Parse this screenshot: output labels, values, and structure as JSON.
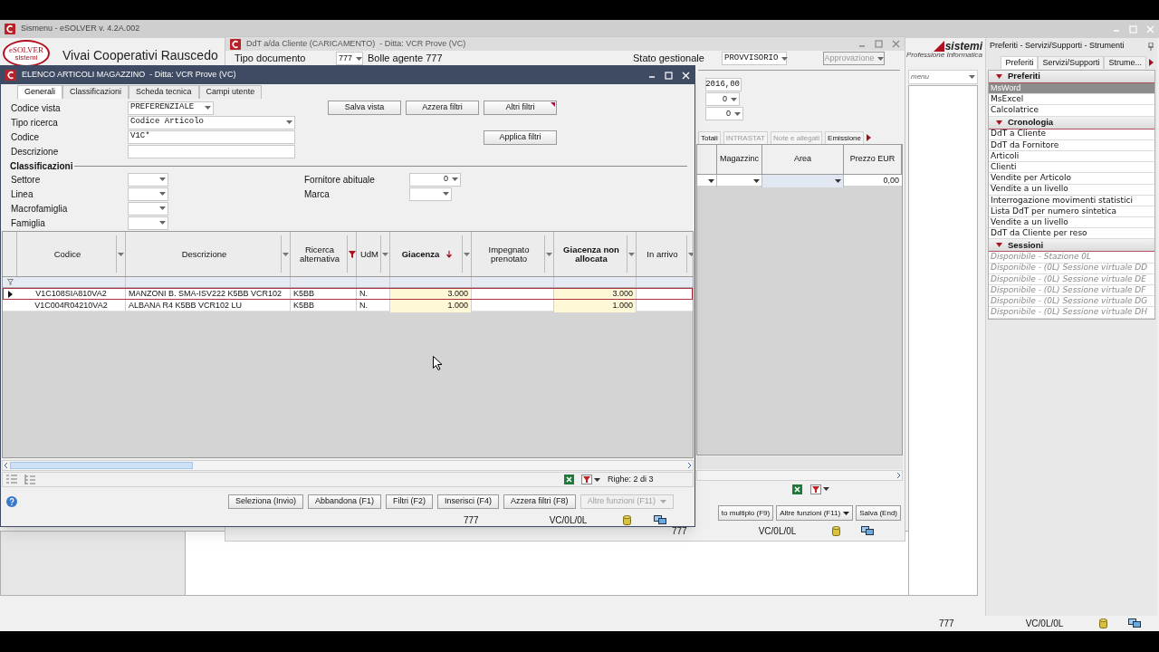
{
  "desktop_window": {
    "title": "Sismenu - eSOLVER v. 4.2A.002",
    "logo": "eSOLVER",
    "logo_tagline": "sistemi",
    "company": "Vivai Cooperativi Rauscedo",
    "brand": "sistemi",
    "brand_tagline": "Professione Informatica",
    "menu_field": "menu",
    "status_bar": [
      "777",
      "VC/0L/0L"
    ]
  },
  "side_panel": {
    "title": "Preferiti - Servizi/Supporti - Strumenti",
    "tabs": [
      {
        "label": "Preferiti",
        "selected": true
      },
      {
        "label": "Servizi/Supporti",
        "selected": false
      },
      {
        "label": "Strume...",
        "selected": false
      }
    ],
    "sections": [
      {
        "title": "Preferiti",
        "expanded": true,
        "kind": "link",
        "items": [
          {
            "label": "MsWord",
            "selected": true
          },
          {
            "label": "MsExcel",
            "selected": false
          },
          {
            "label": "Calcolatrice",
            "selected": false
          }
        ]
      },
      {
        "title": "Cronologia",
        "expanded": true,
        "kind": "link",
        "items": [
          {
            "label": "DdT a Cliente",
            "selected": false
          },
          {
            "label": "DdT da Fornitore",
            "selected": false
          },
          {
            "label": "Articoli",
            "selected": false
          },
          {
            "label": "Clienti",
            "selected": false
          },
          {
            "label": "Vendite per Articolo",
            "selected": false
          },
          {
            "label": "Vendite a un livello",
            "selected": false
          },
          {
            "label": "Interrogazione movimenti statistici",
            "selected": false
          },
          {
            "label": "Lista DdT per numero sintetica",
            "selected": false
          },
          {
            "label": "Vendite a un livello",
            "selected": false
          },
          {
            "label": "DdT da Cliente per reso",
            "selected": false
          }
        ]
      },
      {
        "title": "Sessioni",
        "expanded": true,
        "kind": "session",
        "items": [
          {
            "label": "Disponibile - Stazione 0L",
            "selected": false
          },
          {
            "label": "Disponibile - (0L) Sessione virtuale DD",
            "selected": false
          },
          {
            "label": "Disponibile - (0L) Sessione virtuale DE",
            "selected": false
          },
          {
            "label": "Disponibile - (0L) Sessione virtuale DF",
            "selected": false
          },
          {
            "label": "Disponibile - (0L) Sessione virtuale DG",
            "selected": false
          },
          {
            "label": "Disponibile - (0L) Sessione virtuale DH",
            "selected": false
          }
        ]
      }
    ]
  },
  "document_window": {
    "title": "DdT a/da Cliente (CARICAMENTO)  - Ditta: VCR Prove (VC)",
    "type_label": "Tipo documento",
    "type_value": "777",
    "type_name": "Bolle agente 777",
    "state_label": "Stato gestionale",
    "state_value": "PROVVISORIO",
    "approval_button": {
      "label": "Approvazione",
      "disabled": true
    },
    "values": [
      {
        "kind": "number",
        "value": "2016,00"
      },
      {
        "kind": "combo",
        "value": "0"
      },
      {
        "kind": "combo",
        "value": "0"
      }
    ],
    "tabs": [
      {
        "label": "Totali",
        "disabled": false
      },
      {
        "label": "INTRASTAT",
        "disabled": true
      },
      {
        "label": "Note e allegati",
        "disabled": true
      },
      {
        "label": "Emissione",
        "disabled": false
      }
    ],
    "grid": {
      "columns": [
        "Magazzinc",
        "Area",
        "Prezzo EUR"
      ],
      "price": "0,00"
    },
    "buttons": [
      {
        "label": "to multiplo (F9)",
        "kind": "plain"
      },
      {
        "label": "Altre funzioni (F11)",
        "kind": "menu"
      },
      {
        "label": "Salva (End)",
        "kind": "plain"
      }
    ],
    "status_bar": [
      "777",
      "VC/0L/0L"
    ]
  },
  "list_window": {
    "title": "ELENCO ARTICOLI MAGAZZINO  - Ditta: VCR Prove (VC)",
    "tabs": [
      {
        "label": "Generali",
        "selected": true
      },
      {
        "label": "Classificazioni",
        "selected": false
      },
      {
        "label": "Scheda tecnica",
        "selected": false
      },
      {
        "label": "Campi utente",
        "selected": false
      }
    ],
    "filters": [
      {
        "label": "Codice vista",
        "kind": "short_combo",
        "value": "PREFERENZIALE"
      },
      {
        "label": "Tipo ricerca",
        "kind": "combo",
        "value": "Codice Articolo"
      },
      {
        "label": "Codice",
        "kind": "text",
        "value": "V1C*"
      },
      {
        "label": "Descrizione",
        "kind": "text"
      }
    ],
    "filter_buttons": [
      {
        "label": "Salva vista",
        "kind": "plain"
      },
      {
        "label": "Azzera filtri",
        "kind": "plain"
      },
      {
        "label": "Altri filtri",
        "kind": "flagged"
      },
      {
        "label": "Applica filtri",
        "kind": "plain"
      }
    ],
    "classifications": {
      "title": "Classificazioni",
      "left": [
        {
          "label": "Settore"
        },
        {
          "label": "Linea"
        },
        {
          "label": "Macrofamiglia"
        },
        {
          "label": "Famiglia"
        }
      ],
      "right": [
        {
          "label": "Fornitore abituale",
          "value": "0"
        },
        {
          "label": "Marca"
        }
      ]
    },
    "table": {
      "columns": [
        {
          "label": "Codice",
          "kind": "code",
          "bold": false,
          "filtered": false,
          "sorted": false,
          "highlight": false
        },
        {
          "label": "Descrizione",
          "kind": "text",
          "bold": false,
          "filtered": false,
          "sorted": false,
          "highlight": false
        },
        {
          "label": "Ricerca alternativa",
          "kind": "text",
          "bold": false,
          "filtered": true,
          "sorted": false,
          "highlight": false
        },
        {
          "label": "UdM",
          "kind": "text",
          "bold": false,
          "filtered": false,
          "sorted": false,
          "highlight": false
        },
        {
          "label": "Giacenza",
          "kind": "number",
          "bold": true,
          "filtered": false,
          "sorted": true,
          "highlight": true
        },
        {
          "label": "Impegnato prenotato",
          "kind": "number",
          "bold": false,
          "filtered": false,
          "sorted": false,
          "highlight": false
        },
        {
          "label": "Giacenza non allocata",
          "kind": "number",
          "bold": true,
          "filtered": false,
          "sorted": false,
          "highlight": true
        },
        {
          "label": "In arrivo",
          "kind": "number",
          "bold": false,
          "filtered": false,
          "sorted": false,
          "highlight": false
        }
      ],
      "rows": [
        {
          "selected": true,
          "cells": [
            "V1C108SIA810VA2",
            "MANZONI B. SMA-ISV222 K5BB VCR102",
            "K5BB",
            "N.",
            "3.000",
            null,
            "3.000",
            null
          ]
        },
        {
          "selected": false,
          "cells": [
            "V1C004R04210VA2",
            "ALBANA R4 K5BB VCR102 LU",
            "K5BB",
            "N.",
            "1.000",
            null,
            "1.000",
            null
          ]
        }
      ]
    },
    "row_count": "Righe: 2 di 3",
    "buttons": [
      {
        "label": "Seleziona (Invio)",
        "kind": "plain",
        "disabled": false
      },
      {
        "label": "Abbandona (F1)",
        "kind": "plain",
        "disabled": false
      },
      {
        "label": "Filtri (F2)",
        "kind": "plain",
        "disabled": false
      },
      {
        "label": "Inserisci (F4)",
        "kind": "plain",
        "disabled": false
      },
      {
        "label": "Azzera filtri (F8)",
        "kind": "plain",
        "disabled": false
      },
      {
        "label": "Altre funzioni (F11)",
        "kind": "menu",
        "disabled": true
      }
    ],
    "status_bar": [
      "777",
      "VC/0L/0L"
    ]
  }
}
